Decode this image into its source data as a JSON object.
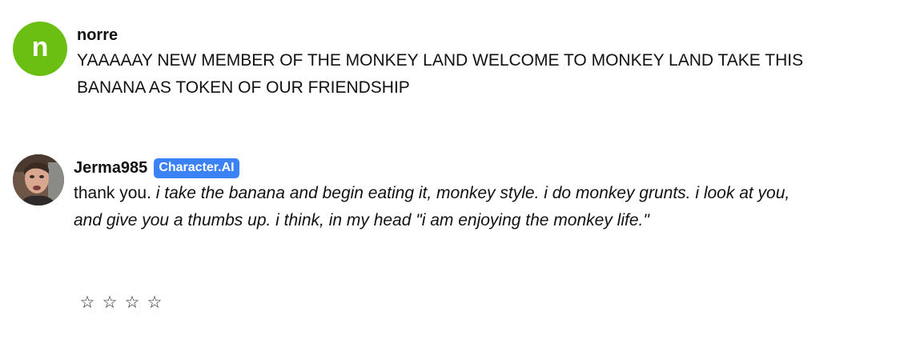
{
  "messages": [
    {
      "author": "norre",
      "avatar_letter": "n",
      "avatar_color": "#6abf12",
      "text": "YAAAAAY NEW MEMBER OF THE MONKEY LAND WELCOME TO MONKEY LAND TAKE THIS BANANA AS TOKEN OF OUR FRIENDSHIP"
    },
    {
      "author": "Jerma985",
      "badge": "Character.AI",
      "badge_color": "#3b82f6",
      "speech": "thank you.",
      "action": "i take the banana and begin eating it, monkey style. i do monkey grunts. i look at you, and give you a thumbs up. i think, in my head \"i am enjoying the monkey life.\""
    }
  ],
  "rating": {
    "stars": [
      "☆",
      "☆",
      "☆",
      "☆"
    ],
    "value": 0
  }
}
